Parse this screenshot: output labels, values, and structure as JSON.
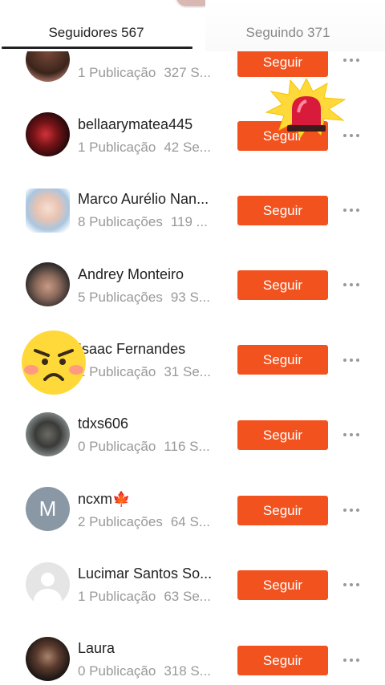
{
  "tabs": {
    "followers_label": "Seguidores 567",
    "following_label": "Seguindo 371"
  },
  "follow_label": "Seguir",
  "users": [
    {
      "name": "",
      "posts": "1 Publicação",
      "followers": "327 S...",
      "avatar": "photo-woman"
    },
    {
      "name": "bellaarymatea445",
      "posts": "1 Publicação",
      "followers": "42 Se...",
      "avatar": "photo-red"
    },
    {
      "name": "Marco Aurélio Nan...",
      "posts": "8 Publicações",
      "followers": "119 ...",
      "avatar": "photo-man"
    },
    {
      "name": "Andrey Monteiro",
      "posts": "5 Publicações",
      "followers": "93 S...",
      "avatar": "photo-man-cap"
    },
    {
      "name": "Isaac Fernandes",
      "posts": "1 Publicação",
      "followers": "31 Se...",
      "avatar": "photo-hidden"
    },
    {
      "name": "tdxs606",
      "posts": "0 Publicação",
      "followers": "116 S...",
      "avatar": "photo-dark"
    },
    {
      "name": "ncxm🍁",
      "posts": "2 Publicações",
      "followers": "64 S...",
      "avatar": "letter",
      "avatar_letter": "M"
    },
    {
      "name": "Lucimar Santos So...",
      "posts": "1 Publicação",
      "followers": "63 Se...",
      "avatar": "default-person-icon"
    },
    {
      "name": "Laura",
      "posts": "0 Publicação",
      "followers": "318 S...",
      "avatar": "photo-woman-dark"
    }
  ],
  "colors": {
    "follow_button": "#f2521e",
    "active_tab_text": "#222222",
    "inactive_tab_text": "#888888",
    "meta_text": "#999999"
  },
  "stickers": [
    "siren-sticker",
    "angry-face-sticker"
  ]
}
